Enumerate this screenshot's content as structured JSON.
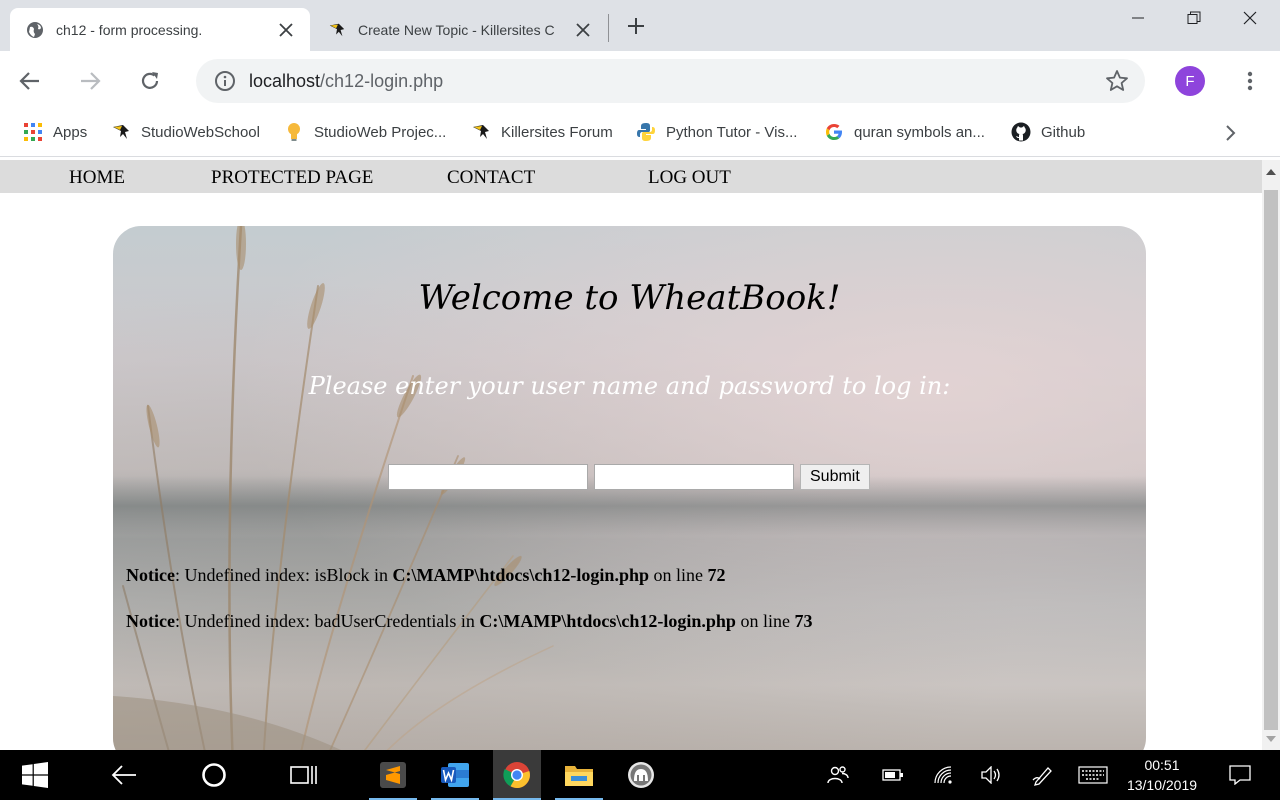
{
  "browser": {
    "tabs": [
      {
        "title": "ch12 - form processing.",
        "active": true,
        "favicon": "globe-icon"
      },
      {
        "title": "Create New Topic - Killersites C",
        "active": false,
        "favicon": "killersites-icon"
      }
    ],
    "address_host": "localhost",
    "address_path": "/ch12-login.php",
    "profile_initial": "F",
    "profile_color": "#8e44dc",
    "bookmarks": [
      {
        "label": "Apps",
        "icon": "apps-grid-icon"
      },
      {
        "label": "StudioWebSchool",
        "icon": "killersites-icon"
      },
      {
        "label": "StudioWeb Projec...",
        "icon": "lightbulb-icon"
      },
      {
        "label": "Killersites Forum",
        "icon": "killersites-icon"
      },
      {
        "label": "Python Tutor - Vis...",
        "icon": "python-icon"
      },
      {
        "label": "quran symbols an...",
        "icon": "google-icon"
      },
      {
        "label": "Github",
        "icon": "github-icon"
      }
    ]
  },
  "site": {
    "nav": [
      "HOME",
      "PROTECTED PAGE",
      "CONTACT",
      "LOG OUT"
    ],
    "heading": "Welcome to WheatBook!",
    "subheading": "Please enter your user name and password to log in:",
    "form": {
      "username_value": "",
      "password_value": "",
      "submit_label": "Submit"
    },
    "notices": [
      {
        "label": "Notice",
        "message": ": Undefined index: isBlock in ",
        "file": "C:\\MAMP\\htdocs\\ch12-login.php",
        "line_text": " on line ",
        "line": "72"
      },
      {
        "label": "Notice",
        "message": ": Undefined index: badUserCredentials in ",
        "file": "C:\\MAMP\\htdocs\\ch12-login.php",
        "line_text": " on line ",
        "line": "73"
      }
    ]
  },
  "taskbar": {
    "time": "00:51",
    "date": "13/10/2019",
    "apps": [
      "sublime-text-icon",
      "word-icon",
      "chrome-icon",
      "file-explorer-icon",
      "mamp-icon"
    ]
  }
}
